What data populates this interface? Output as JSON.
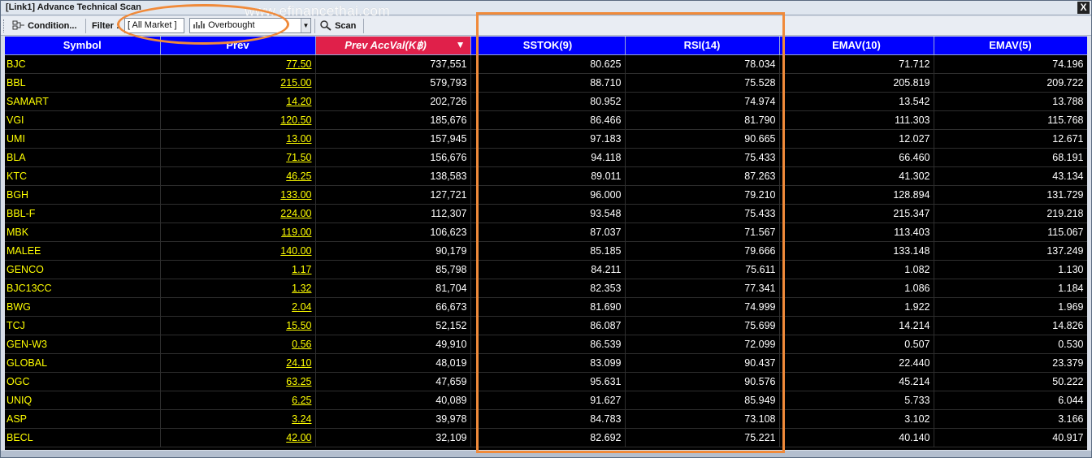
{
  "window": {
    "title": "[Link1] Advance Technical Scan",
    "close_label": "X",
    "watermark": "www.efinancethai.com"
  },
  "toolbar": {
    "condition_label": "Condition...",
    "filter_label": "Filter :",
    "market_value": "[ All Market ]",
    "scan_type_value": "Overbought",
    "scan_label": "Scan"
  },
  "table": {
    "columns": [
      "Symbol",
      "Prev",
      "Prev AccVal(K฿)",
      "SSTOK(9)",
      "RSI(14)",
      "EMAV(10)",
      "EMAV(5)"
    ],
    "sort_indicator": "▼",
    "rows": [
      [
        "BJC",
        "77.50",
        "737,551",
        "80.625",
        "78.034",
        "71.712",
        "74.196"
      ],
      [
        "BBL",
        "215.00",
        "579,793",
        "88.710",
        "75.528",
        "205.819",
        "209.722"
      ],
      [
        "SAMART",
        "14.20",
        "202,726",
        "80.952",
        "74.974",
        "13.542",
        "13.788"
      ],
      [
        "VGI",
        "120.50",
        "185,676",
        "86.466",
        "81.790",
        "111.303",
        "115.768"
      ],
      [
        "UMI",
        "13.00",
        "157,945",
        "97.183",
        "90.665",
        "12.027",
        "12.671"
      ],
      [
        "BLA",
        "71.50",
        "156,676",
        "94.118",
        "75.433",
        "66.460",
        "68.191"
      ],
      [
        "KTC",
        "46.25",
        "138,583",
        "89.011",
        "87.263",
        "41.302",
        "43.134"
      ],
      [
        "BGH",
        "133.00",
        "127,721",
        "96.000",
        "79.210",
        "128.894",
        "131.729"
      ],
      [
        "BBL-F",
        "224.00",
        "112,307",
        "93.548",
        "75.433",
        "215.347",
        "219.218"
      ],
      [
        "MBK",
        "119.00",
        "106,623",
        "87.037",
        "71.567",
        "113.403",
        "115.067"
      ],
      [
        "MALEE",
        "140.00",
        "90,179",
        "85.185",
        "79.666",
        "133.148",
        "137.249"
      ],
      [
        "GENCO",
        "1.17",
        "85,798",
        "84.211",
        "75.611",
        "1.082",
        "1.130"
      ],
      [
        "BJC13CC",
        "1.32",
        "81,704",
        "82.353",
        "77.341",
        "1.086",
        "1.184"
      ],
      [
        "BWG",
        "2.04",
        "66,673",
        "81.690",
        "74.999",
        "1.922",
        "1.969"
      ],
      [
        "TCJ",
        "15.50",
        "52,152",
        "86.087",
        "75.699",
        "14.214",
        "14.826"
      ],
      [
        "GEN-W3",
        "0.56",
        "49,910",
        "86.539",
        "72.099",
        "0.507",
        "0.530"
      ],
      [
        "GLOBAL",
        "24.10",
        "48,019",
        "83.099",
        "90.437",
        "22.440",
        "23.379"
      ],
      [
        "OGC",
        "63.25",
        "47,659",
        "95.631",
        "90.576",
        "45.214",
        "50.222"
      ],
      [
        "UNIQ",
        "6.25",
        "40,089",
        "91.627",
        "85.949",
        "5.733",
        "6.044"
      ],
      [
        "ASP",
        "3.24",
        "39,978",
        "84.783",
        "73.108",
        "3.102",
        "3.166"
      ],
      [
        "BECL",
        "42.00",
        "32,109",
        "82.692",
        "75.221",
        "40.140",
        "40.917"
      ]
    ]
  },
  "colors": {
    "header_bg": "#0000ff",
    "active_header_bg": "#e0204a",
    "symbol_color": "#ffff00",
    "annotation_orange": "#f08a3a"
  }
}
